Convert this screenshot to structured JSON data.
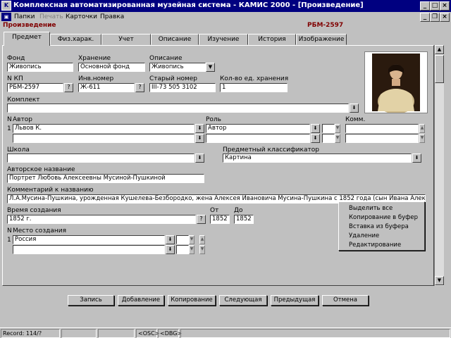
{
  "window": {
    "title": "Комплексная автоматизированная музейная система - КАМИС 2000 - [Произведение]"
  },
  "menu": {
    "items": [
      "Папки",
      "Печать",
      "Карточки",
      "Правка"
    ]
  },
  "record": {
    "title": "Произведение",
    "code": "РБМ-2597"
  },
  "tabs": [
    "Предмет",
    "Физ.харак.",
    "Учет",
    "Описание",
    "Изучение",
    "История",
    "Изображение"
  ],
  "form": {
    "fond_label": "Фонд",
    "fond": "Живопись",
    "storage_label": "Хранение",
    "storage": "Основной фонд",
    "desc_label": "Описание",
    "desc": "Живопись",
    "kp_label": "N  КП",
    "kp": "РБМ-2597",
    "inv_label": "Инв.номер",
    "inv": "Ж-611",
    "old_label": "Старый номер",
    "old": "III-73 505 3102",
    "units_label": "Кол-во ед. хранения",
    "units": "1",
    "kit_label": "Комплект",
    "author_n_label": "N",
    "author_label": "Автор",
    "author_row1_n": "1",
    "author_row1": "Львов К.",
    "role_label": "Роль",
    "role_row1": "Автор",
    "comm_label": "Комм.",
    "school_label": "Школа",
    "classifier_label": "Предметный классификатор",
    "classifier": "Картина",
    "author_title_label": "Авторское название",
    "author_title": "Портрет Любовь Алексеевны Мусиной-Пушкиной",
    "comment_label": "Комментарий к названию",
    "comment": "Л.А.Мусина-Пушкина, урожденная Кушелева-Безбородко, жена Алексея Ивановича Мусина-Пушкина с 1852 года (сын Ивана Алексеевича -",
    "time_label": "Время создания",
    "time": "1852 г.",
    "from_label": "От",
    "from": "1852",
    "to_label": "До",
    "to": "1852",
    "place_n_label": "N",
    "place_label": "Место создания",
    "place_row1_n": "1",
    "place_row1": "Россия"
  },
  "context_menu": [
    "Выделить все",
    "Копирование в буфер",
    "Вставка из буфера",
    "Удаление",
    "Редактирование"
  ],
  "buttons": [
    "Запись",
    "Добавление",
    "Копирование",
    "Следующая",
    "Предыдущая",
    "Отмена"
  ],
  "status": {
    "record": "Record: 114/?",
    "osc": "<OSC>",
    "dbg": "<DBG>"
  }
}
